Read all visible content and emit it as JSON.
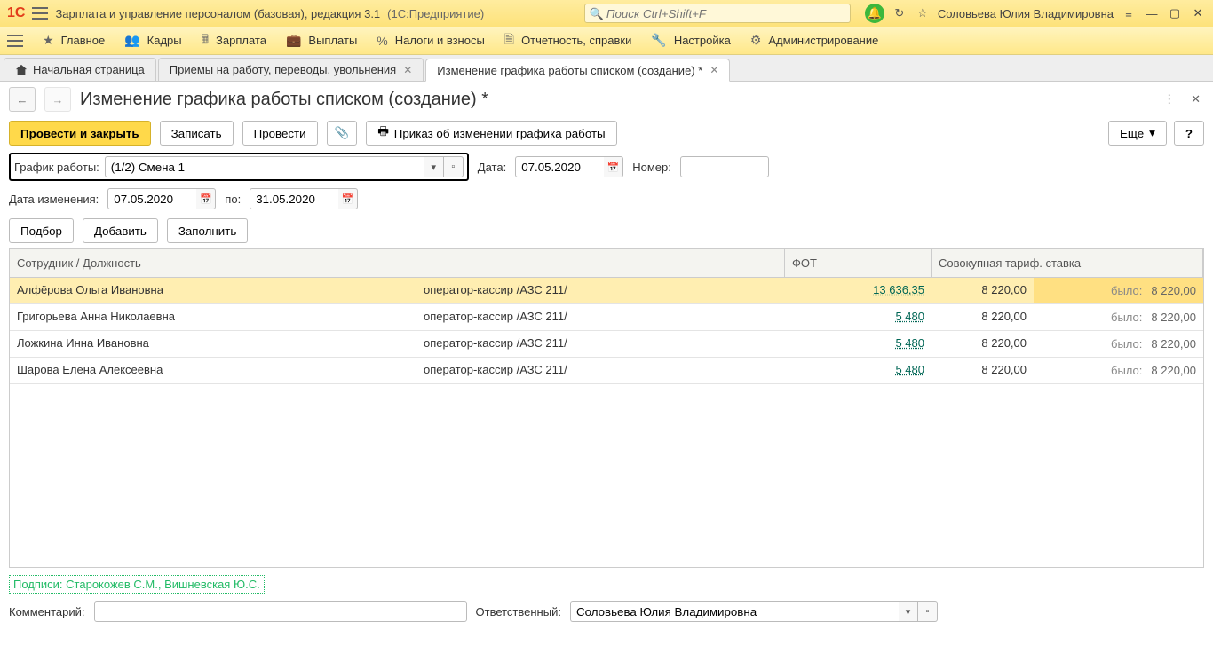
{
  "title": {
    "app": "Зарплата и управление персоналом (базовая), редакция 3.1",
    "sub": "(1С:Предприятие)",
    "user": "Соловьева Юлия Владимировна"
  },
  "search": {
    "placeholder": "Поиск Ctrl+Shift+F"
  },
  "menu": {
    "main": "Главное",
    "kadry": "Кадры",
    "zarplata": "Зарплата",
    "vyplaty": "Выплаты",
    "nalogi": "Налоги и взносы",
    "otchet": "Отчетность, справки",
    "nastr": "Настройка",
    "admin": "Администрирование"
  },
  "tabs": {
    "home": "Начальная страница",
    "t1": "Приемы на работу, переводы, увольнения",
    "t2": "Изменение графика работы списком (создание) *"
  },
  "pageTitle": "Изменение графика работы списком (создание) *",
  "toolbar": {
    "post_close": "Провести и закрыть",
    "save": "Записать",
    "post": "Провести",
    "print": "Приказ об изменении графика работы",
    "more": "Еще",
    "help": "?"
  },
  "form": {
    "grafik_label": "График работы:",
    "grafik_value": "(1/2) Смена 1",
    "date_label": "Дата:",
    "date_value": "07.05.2020",
    "number_label": "Номер:",
    "number_value": "",
    "change_label": "Дата изменения:",
    "change_value": "07.05.2020",
    "to_label": "по:",
    "to_value": "31.05.2020"
  },
  "actions": {
    "podbor": "Подбор",
    "add": "Добавить",
    "fill": "Заполнить"
  },
  "grid": {
    "h1": "Сотрудник / Должность",
    "h2": "",
    "h3": "ФОТ",
    "h4": "Совокупная тариф. ставка",
    "was": "было:",
    "rows": [
      {
        "emp": "Алфёрова Ольга Ивановна",
        "pos": "оператор-кассир /АЗС 211/",
        "fot": "13 636,35",
        "rate": "8 220,00",
        "was": "8 220,00",
        "sel": true
      },
      {
        "emp": "Григорьева Анна Николаевна",
        "pos": "оператор-кассир /АЗС 211/",
        "fot": "5 480",
        "rate": "8 220,00",
        "was": "8 220,00"
      },
      {
        "emp": "Ложкина Инна Ивановна",
        "pos": "оператор-кассир /АЗС 211/",
        "fot": "5 480",
        "rate": "8 220,00",
        "was": "8 220,00"
      },
      {
        "emp": "Шарова Елена Алексеевна",
        "pos": "оператор-кассир /АЗС 211/",
        "fot": "5 480",
        "rate": "8 220,00",
        "was": "8 220,00"
      }
    ]
  },
  "signs": "Подписи: Старокожев С.М., Вишневская Ю.С.",
  "bottom": {
    "comment_label": "Комментарий:",
    "comment_value": "",
    "resp_label": "Ответственный:",
    "resp_value": "Соловьева Юлия Владимировна"
  }
}
